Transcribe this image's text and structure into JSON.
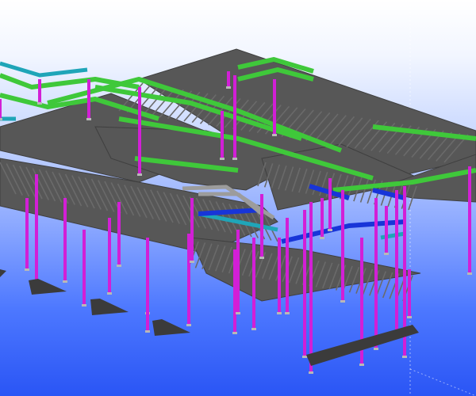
{
  "viewport": {
    "background_top": "#ffffff",
    "background_bottom": "#2a55f5"
  },
  "model": {
    "colors": {
      "deck": "#575757",
      "deck_edge": "#3f3f3f",
      "joist": "#6a6a6a",
      "green_beam": "#3fc83a",
      "teal_beam": "#1fa5b8",
      "column": "#d21fd6",
      "blue_beam": "#1835d8",
      "grey_brace": "#9c9c9c",
      "footing": "#3b3b3b"
    }
  }
}
